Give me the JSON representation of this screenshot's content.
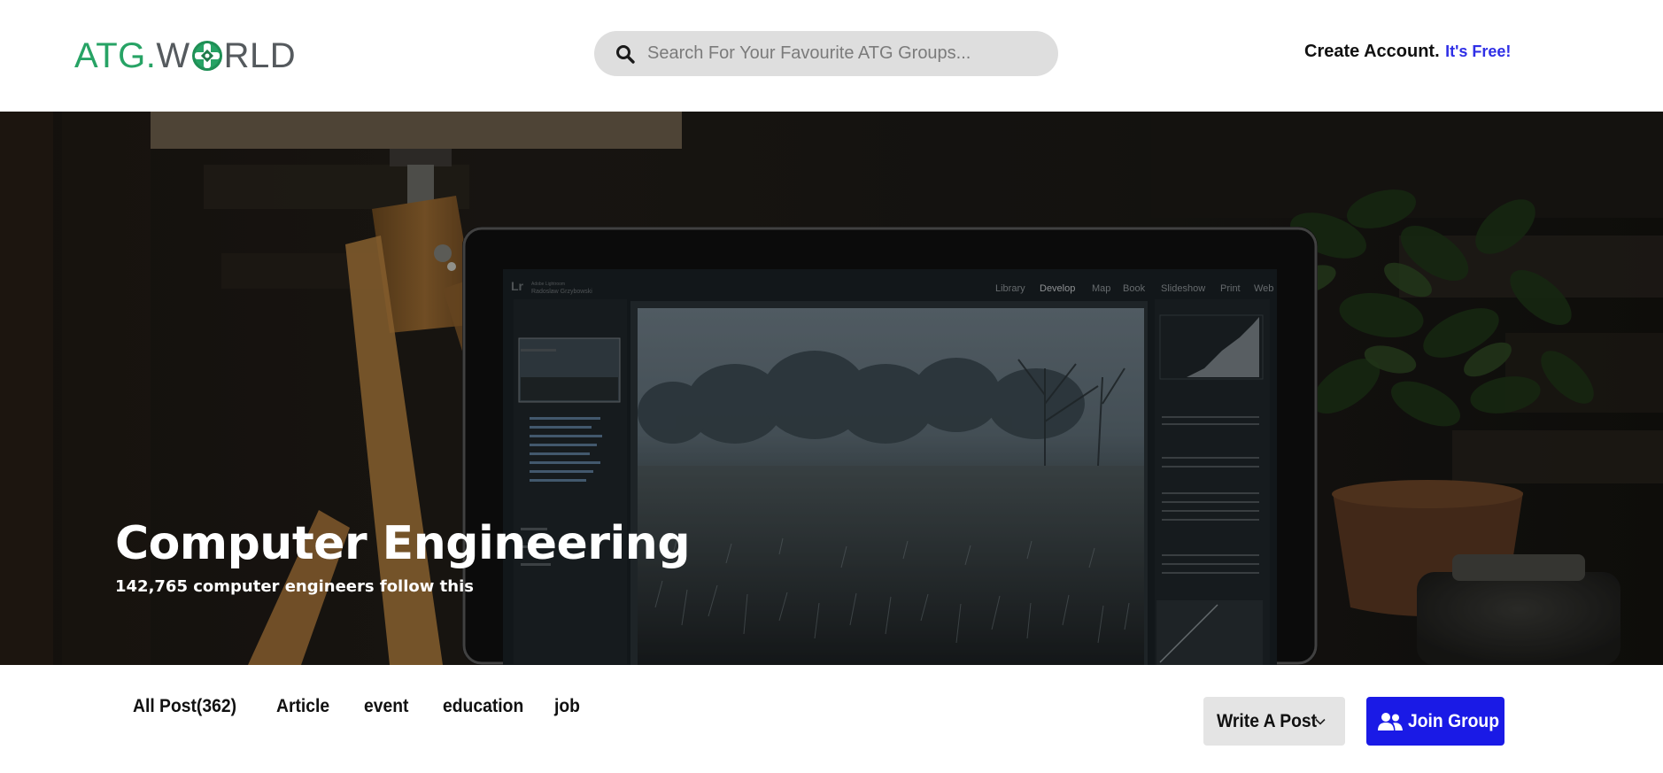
{
  "header": {
    "logo": {
      "text_before": "ATG.W",
      "text_after": "RLD",
      "icon": "atg-logo-icon",
      "color_atg": "#27a365",
      "color_world": "#555a5e"
    },
    "search": {
      "placeholder": "Search For Your Favourite ATG Groups...",
      "value": "",
      "icon": "search-icon"
    },
    "create_account": {
      "label": "Create Account.",
      "free_label": "It's Free!",
      "free_color": "#2f2fe6"
    }
  },
  "hero": {
    "title": "Computer Engineering",
    "subtitle": "142,765 computer engineers follow this",
    "screen_menu": [
      "Library",
      "Develop",
      "Map",
      "Book",
      "Slideshow",
      "Print",
      "Web"
    ],
    "screen_app_mark": "Lr"
  },
  "tabs": {
    "items": [
      {
        "label": "All Post(362)"
      },
      {
        "label": "Article"
      },
      {
        "label": "event"
      },
      {
        "label": "education"
      },
      {
        "label": "job"
      }
    ]
  },
  "actions": {
    "write_post_label": "Write A Post",
    "write_post_icon": "chevron-down-icon",
    "join_group_label": "Join Group",
    "join_group_icon": "users-icon",
    "join_group_color": "#1a1ae6"
  }
}
